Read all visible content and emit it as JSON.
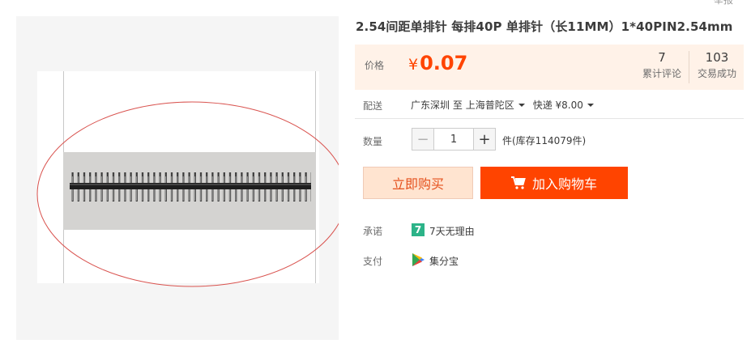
{
  "header": {
    "report_label": "举报"
  },
  "product": {
    "title": "2.54间距单排针 每排40P 单排针（长11MM）1*40PIN2.54mm",
    "image_alt": "单排针产品图"
  },
  "price": {
    "label": "价格",
    "currency": "¥",
    "value": "0.07",
    "color": "#ff4400"
  },
  "stats": {
    "reviews_count": "7",
    "reviews_label": "累计评论",
    "sales_count": "103",
    "sales_label": "交易成功"
  },
  "delivery": {
    "label": "配送",
    "from": "广东深圳",
    "to_word": "至",
    "to": "上海普陀区",
    "shipping": "快递 ¥8.00"
  },
  "quantity": {
    "label": "数量",
    "minus": "−",
    "value": "1",
    "plus": "+",
    "unit_stock": "件(库存114079件)"
  },
  "actions": {
    "buy_now": "立即购买",
    "add_to_cart": "加入购物车",
    "cart_icon": "shopping-cart-icon"
  },
  "service": {
    "promise_label": "承诺",
    "promise_icon_text": "7",
    "promise_text": "7天无理由",
    "payment_label": "支付",
    "payment_text": "集分宝",
    "payment_icon": "play-triangle-icon"
  }
}
